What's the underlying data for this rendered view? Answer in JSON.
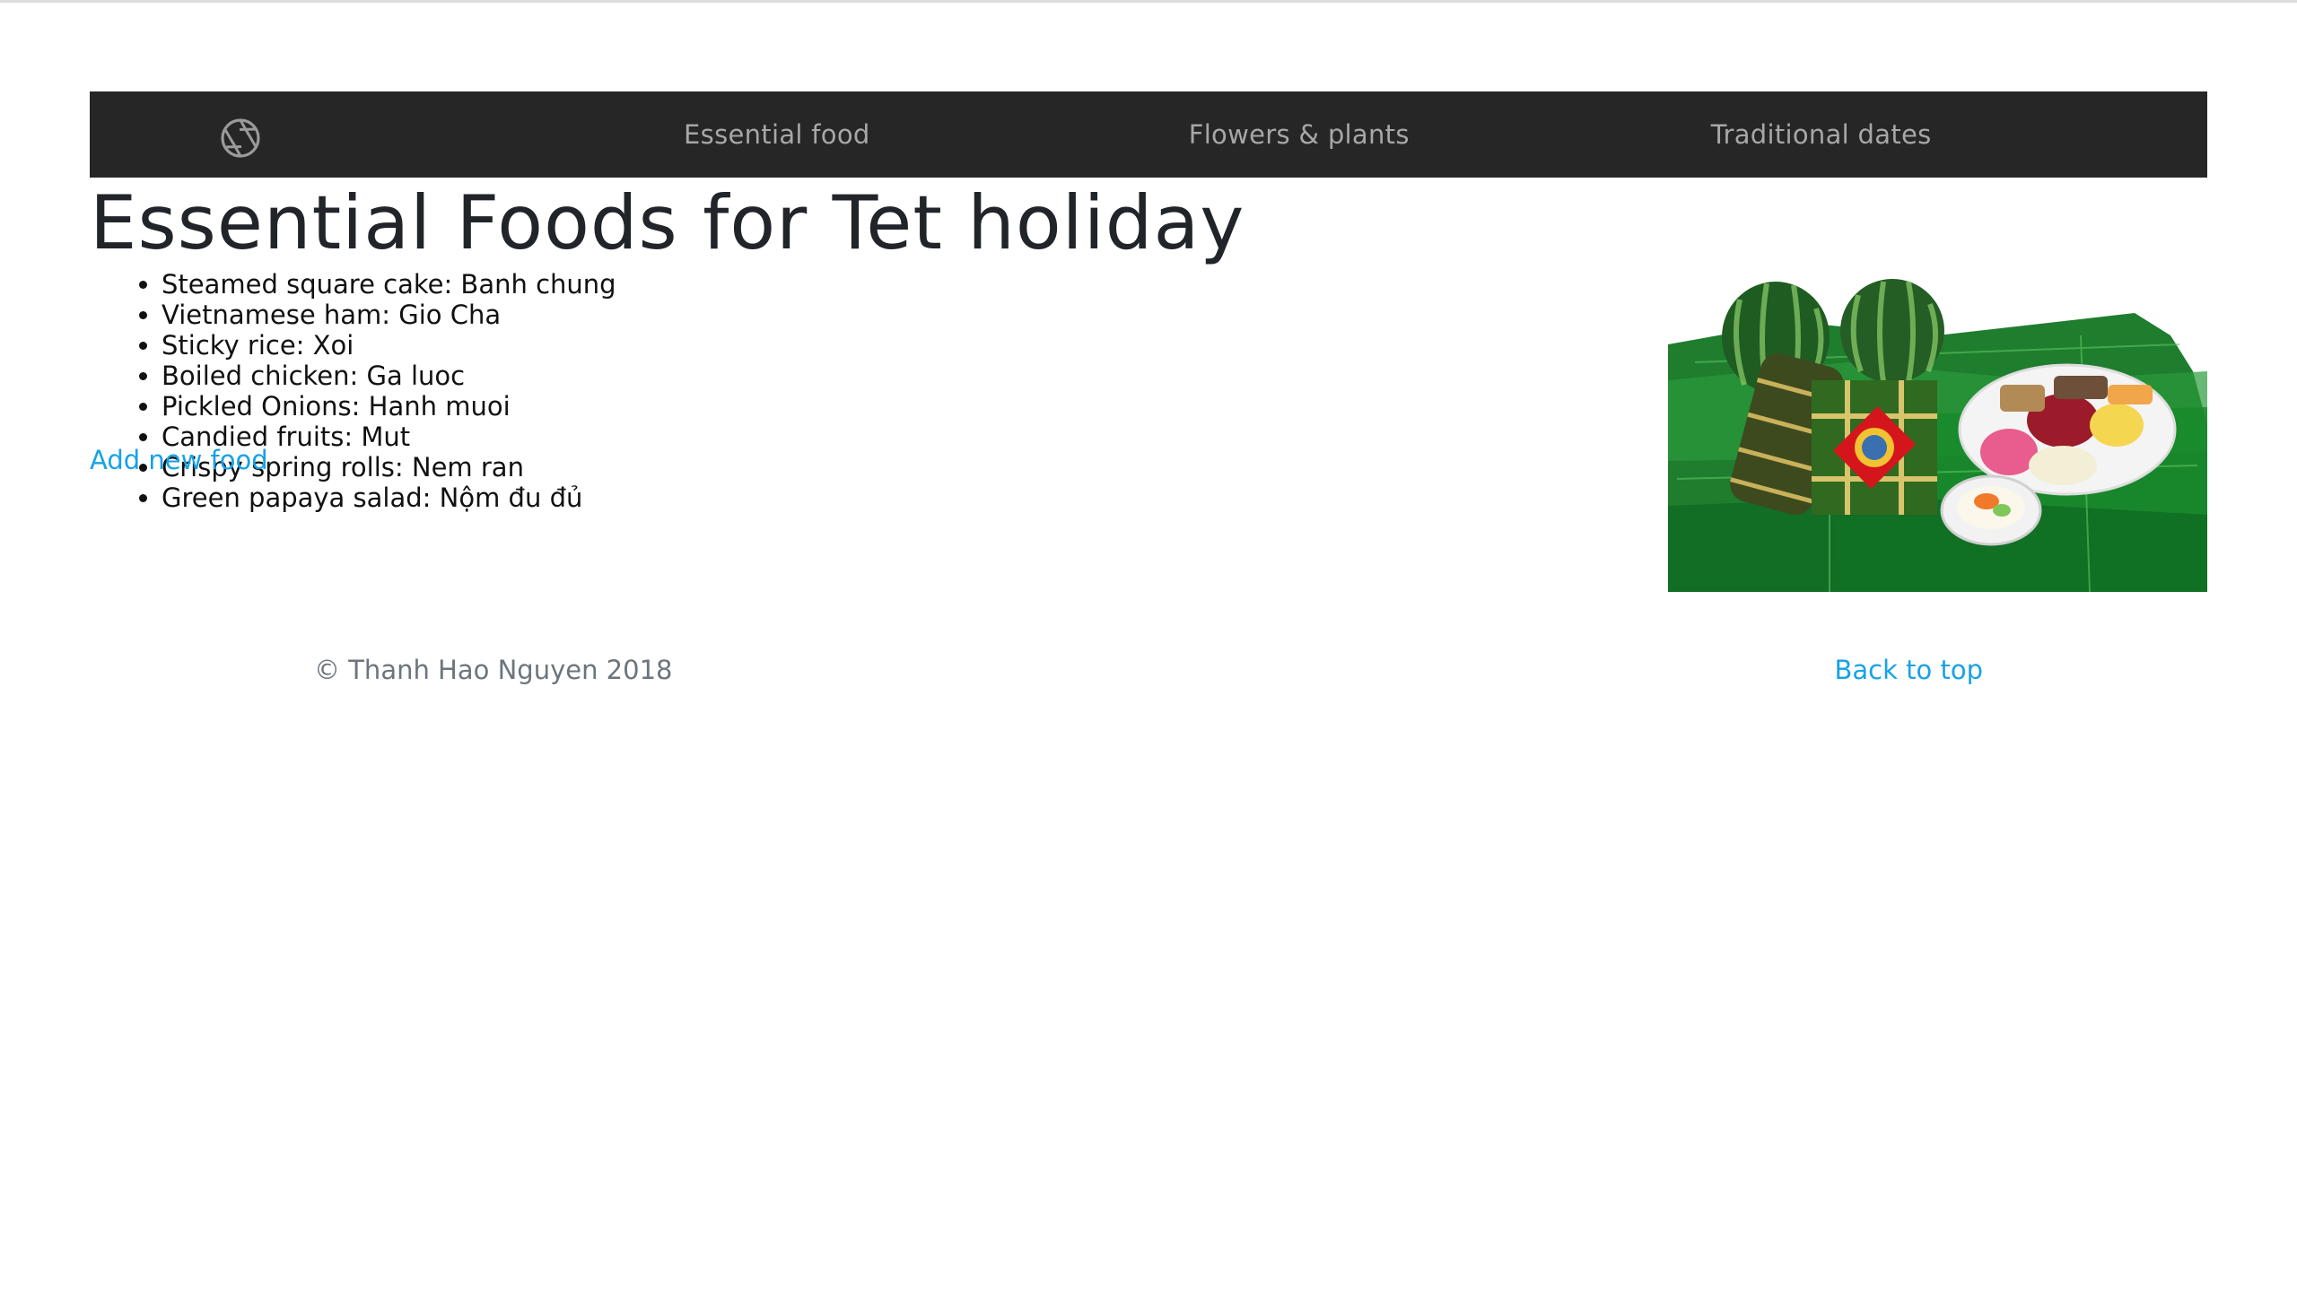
{
  "nav": {
    "brand_icon": "camera-aperture-icon",
    "items": [
      {
        "label": "Essential food"
      },
      {
        "label": "Flowers & plants"
      },
      {
        "label": "Traditional dates"
      }
    ]
  },
  "main": {
    "title": "Essential Foods for Tet holiday",
    "foods": [
      "Steamed square cake: Banh chung",
      "Vietnamese ham: Gio Cha",
      "Sticky rice: Xoi",
      "Boiled chicken: Ga luoc",
      "Pickled Onions: Hanh muoi",
      "Candied fruits: Mut",
      "Crispy spring rolls: Nem ran",
      "Green papaya salad: Nộm đu đủ"
    ],
    "add_link": "Add new food",
    "image_alt": "Tet food platter with banh chung, watermelons and pickles on banana leaves"
  },
  "footer": {
    "copyright": "© Thanh Hao Nguyen 2018",
    "back_to_top": "Back to top"
  },
  "colors": {
    "navbar_bg": "#262626",
    "nav_text": "#a7a7a7",
    "link": "#17a2e6",
    "muted": "#6c757d"
  }
}
